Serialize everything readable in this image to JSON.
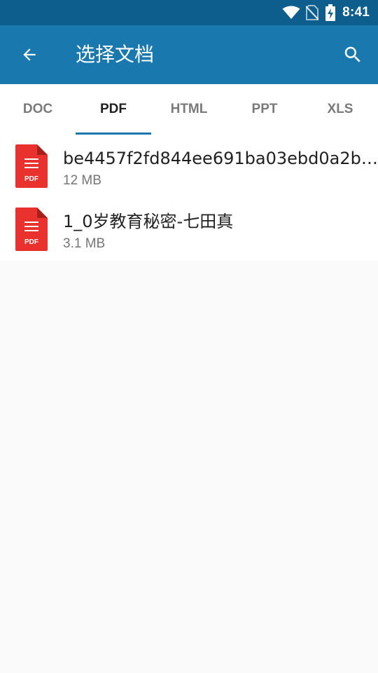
{
  "status_bar": {
    "time": "8:41",
    "icons": [
      "wifi-icon",
      "no-sim-icon",
      "battery-charging-icon"
    ]
  },
  "app_bar": {
    "title": "选择文档",
    "back_icon": "arrow-back-icon",
    "search_icon": "search-icon",
    "background": "#1978ad"
  },
  "tabs": [
    {
      "label": "DOC",
      "active": false
    },
    {
      "label": "PDF",
      "active": true
    },
    {
      "label": "HTML",
      "active": false
    },
    {
      "label": "PPT",
      "active": false
    },
    {
      "label": "XLS",
      "active": false
    }
  ],
  "files": [
    {
      "name": "be4457f2fd844ee691ba03ebd0a2b9...",
      "size": "12 MB",
      "icon": "pdf-file-icon",
      "badge": "PDF"
    },
    {
      "name": "1_0岁教育秘密-七田真",
      "size": "3.1 MB",
      "icon": "pdf-file-icon",
      "badge": "PDF"
    }
  ],
  "colors": {
    "status_bar": "#0e5e8d",
    "accent": "#1978ad",
    "pdf_red": "#e9322d"
  }
}
